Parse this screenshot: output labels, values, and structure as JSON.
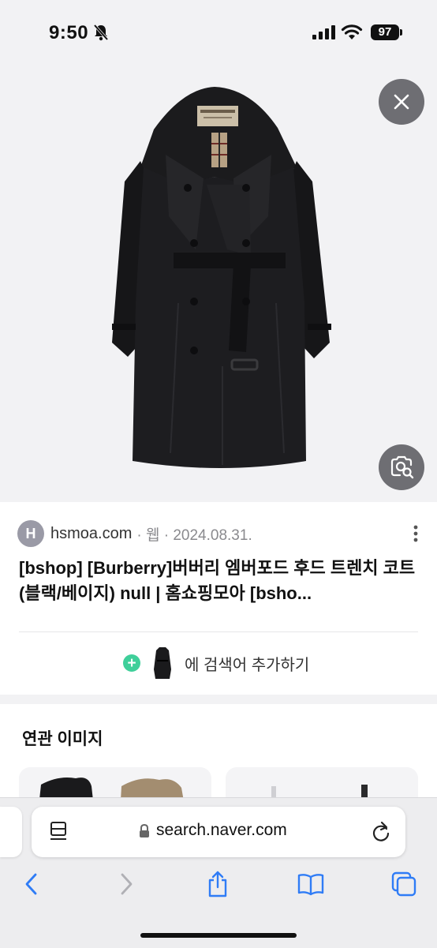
{
  "status_bar": {
    "time": "9:50",
    "battery": "97"
  },
  "viewer": {
    "close_icon": "close-icon",
    "lens_icon": "visual-search-icon"
  },
  "result": {
    "source_initial": "H",
    "source_domain": "hsmoa.com",
    "source_meta": "· 웹 · 2024.08.31.",
    "title": "[bshop] [Burberry]버버리 엠버포드 후드 트렌치 코트 (블랙/베이지) null | 홈쇼핑모아 [bsho...",
    "add_search_label": "에 검색어 추가하기"
  },
  "related": {
    "title": "연관 이미지"
  },
  "browser": {
    "url": "search.naver.com"
  },
  "colors": {
    "accent_plus": "#3fcf9a",
    "ios_blue": "#2f7cf6",
    "overlay_button": "#6e6e73"
  }
}
